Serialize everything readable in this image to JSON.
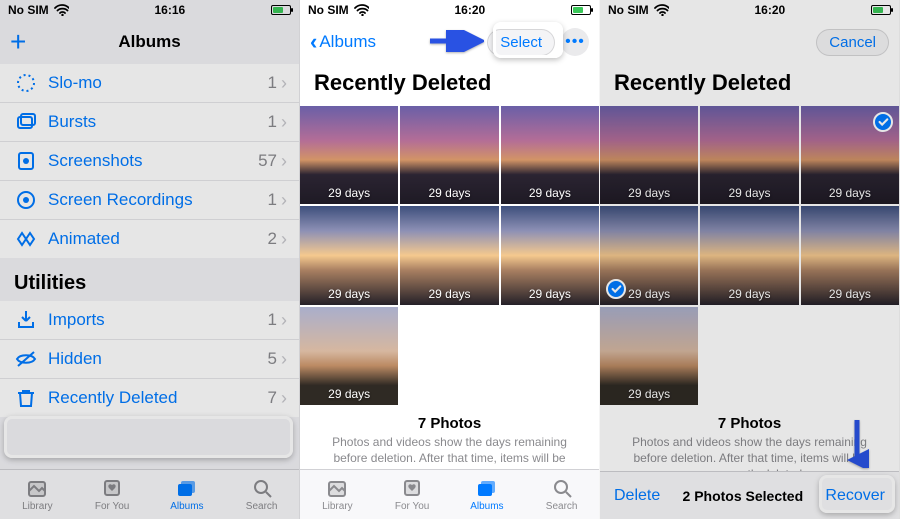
{
  "colors": {
    "accent": "#007aff"
  },
  "status": {
    "carrier": "No SIM",
    "time1": "16:16",
    "time2": "16:20",
    "time3": "16:20"
  },
  "screen1": {
    "nav_title": "Albums",
    "media_types": [
      {
        "icon": "slomo",
        "label": "Slo-mo",
        "count": "1"
      },
      {
        "icon": "bursts",
        "label": "Bursts",
        "count": "1"
      },
      {
        "icon": "screens",
        "label": "Screenshots",
        "count": "57"
      },
      {
        "icon": "record",
        "label": "Screen Recordings",
        "count": "1"
      },
      {
        "icon": "animated",
        "label": "Animated",
        "count": "2"
      }
    ],
    "utilities_header": "Utilities",
    "utilities": [
      {
        "icon": "imports",
        "label": "Imports",
        "count": "1"
      },
      {
        "icon": "hidden",
        "label": "Hidden",
        "count": "5"
      },
      {
        "icon": "trash",
        "label": "Recently Deleted",
        "count": "7"
      }
    ],
    "tabs": {
      "library": "Library",
      "foryou": "For You",
      "albums": "Albums",
      "search": "Search"
    }
  },
  "screen2": {
    "back_label": "Albums",
    "select_label": "Select",
    "title": "Recently Deleted",
    "thumbs": [
      {
        "days": "29 days",
        "sky": "a"
      },
      {
        "days": "29 days",
        "sky": "a"
      },
      {
        "days": "29 days",
        "sky": "a"
      },
      {
        "days": "29 days",
        "sky": "b"
      },
      {
        "days": "29 days",
        "sky": "b"
      },
      {
        "days": "29 days",
        "sky": "b"
      },
      {
        "days": "29 days",
        "sky": "c"
      }
    ],
    "info_count": "7 Photos",
    "info_desc": "Photos and videos show the days remaining before deletion. After that time, items will be permanently deleted.",
    "tabs": {
      "library": "Library",
      "foryou": "For You",
      "albums": "Albums",
      "search": "Search"
    }
  },
  "screen3": {
    "cancel_label": "Cancel",
    "title": "Recently Deleted",
    "thumbs": [
      {
        "days": "29 days",
        "sky": "a",
        "selected": false
      },
      {
        "days": "29 days",
        "sky": "a",
        "selected": false
      },
      {
        "days": "29 days",
        "sky": "a",
        "selected": true
      },
      {
        "days": "29 days",
        "sky": "b",
        "selected": true
      },
      {
        "days": "29 days",
        "sky": "b",
        "selected": false
      },
      {
        "days": "29 days",
        "sky": "b",
        "selected": false
      },
      {
        "days": "29 days",
        "sky": "c",
        "selected": false
      }
    ],
    "info_count": "7 Photos",
    "info_desc": "Photos and videos show the days remaining before deletion. After that time, items will be permanently deleted.",
    "toolbar": {
      "delete": "Delete",
      "mid": "2 Photos Selected",
      "recover": "Recover"
    }
  }
}
